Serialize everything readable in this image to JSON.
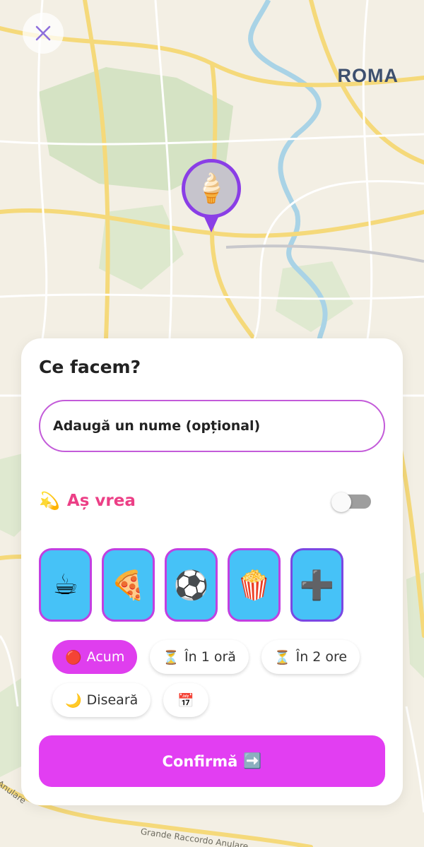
{
  "map": {
    "city_label": "ROMA",
    "road_label_main": "Grande Raccordo Anulare",
    "road_label_side": "Anulare",
    "pin_emoji": "🍦"
  },
  "close_icon_name": "close-icon",
  "sheet": {
    "title": "Ce facem?",
    "name_placeholder": "Adaugă un nume (opțional)",
    "wish": {
      "emoji": "💫",
      "label": "Aș vrea",
      "toggle_on": false
    },
    "categories": [
      {
        "emoji": "☕",
        "name": "coffee-icon"
      },
      {
        "emoji": "🍕",
        "name": "pizza-icon"
      },
      {
        "emoji": "⚽",
        "name": "soccer-ball-icon"
      },
      {
        "emoji": "🍿",
        "name": "popcorn-icon"
      },
      {
        "emoji": "➕",
        "name": "plus-icon"
      }
    ],
    "time_chips": [
      {
        "icon": "🔴",
        "label": "Acum",
        "active": true
      },
      {
        "icon": "⏳",
        "label": "În 1 oră",
        "active": false
      },
      {
        "icon": "⏳",
        "label": "În 2 ore",
        "active": false
      },
      {
        "icon": "🌙",
        "label": "Diseară",
        "active": false
      },
      {
        "icon": "📅",
        "label": "",
        "active": false
      }
    ],
    "confirm_label": "Confirmă",
    "confirm_icon": "➡️"
  },
  "colors": {
    "accent": "#e23ef2",
    "wish_text": "#ec3f86",
    "category_bg": "#46c2f7",
    "pin_border": "#8a3ee6"
  }
}
